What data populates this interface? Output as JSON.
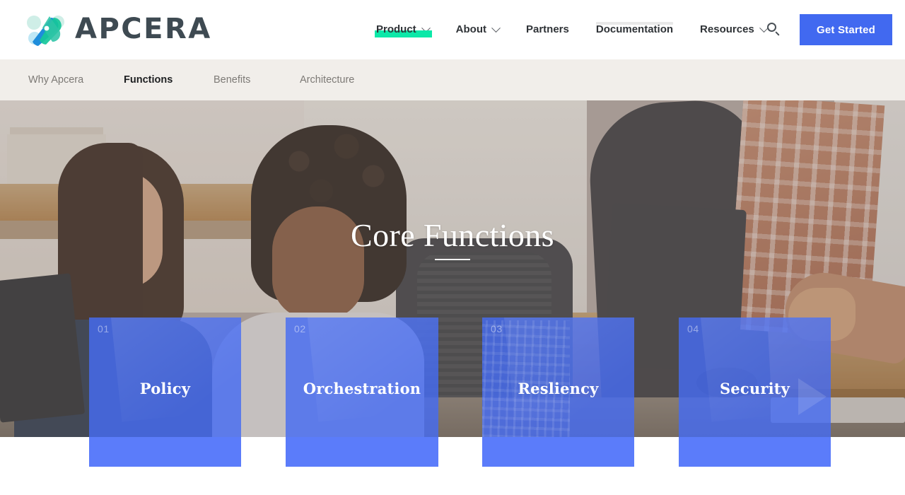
{
  "brand": {
    "name": "APCERA",
    "logo_icon": "apcera-propeller-logo",
    "logo_colors": [
      "#1f8ddb",
      "#2ec4a6",
      "#16c79a",
      "#b9e4dd"
    ]
  },
  "header": {
    "nav": [
      {
        "label": "Product",
        "has_dropdown": true,
        "active": true,
        "highlight_color": "#0ce8a8"
      },
      {
        "label": "About",
        "has_dropdown": true,
        "active": false
      },
      {
        "label": "Partners",
        "has_dropdown": false,
        "active": false
      },
      {
        "label": "Documentation",
        "has_dropdown": false,
        "active": false
      },
      {
        "label": "Resources",
        "has_dropdown": true,
        "active": false
      }
    ],
    "search_icon": "search-icon",
    "cta": {
      "label": "Get Started",
      "color": "#4169f0"
    }
  },
  "subnav": {
    "items": [
      {
        "label": "Why Apcera",
        "active": false
      },
      {
        "label": "Functions",
        "active": true
      },
      {
        "label": "Benefits",
        "active": false
      },
      {
        "label": "Architecture",
        "active": false
      }
    ],
    "background": "#f1eeea"
  },
  "hero": {
    "title": "Core Functions",
    "divider": true,
    "image_description": "office workspace with colleagues at desks"
  },
  "cards": [
    {
      "number": "01",
      "title": "Policy"
    },
    {
      "number": "02",
      "title": "Orchestration"
    },
    {
      "number": "03",
      "title": "Resliency"
    },
    {
      "number": "04",
      "title": "Security"
    }
  ],
  "colors": {
    "card_overlay": "#466bf2",
    "card_footer": "#5b7cfa",
    "accent_green": "#0ce8a8",
    "brand_blue": "#4169f0",
    "logo_text": "#3e4a52"
  }
}
